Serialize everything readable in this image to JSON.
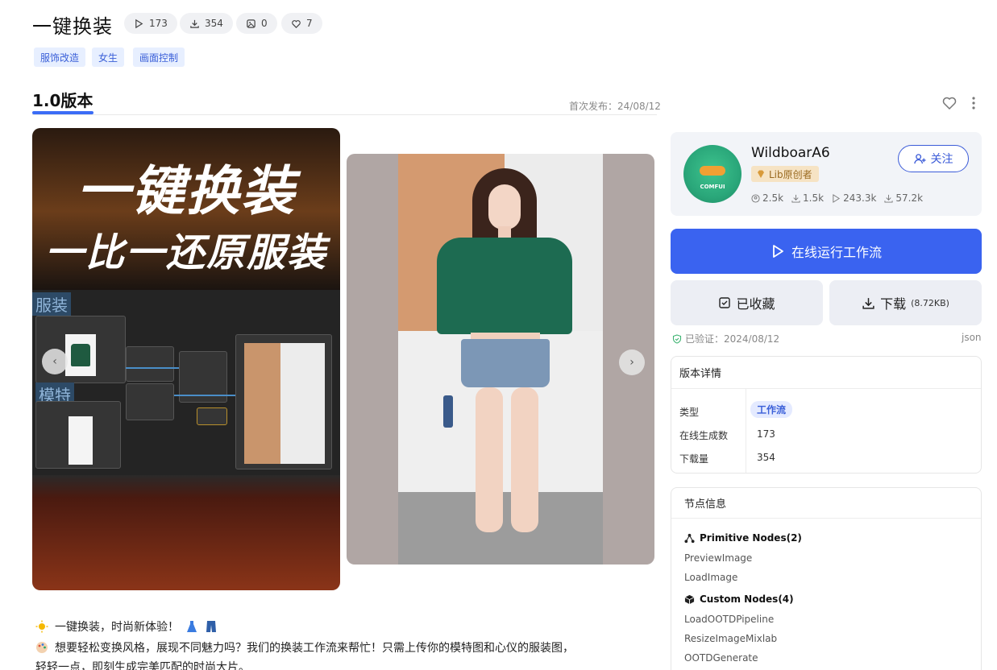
{
  "header": {
    "title": "一键换装",
    "stats": [
      {
        "icon": "play-icon",
        "value": "173"
      },
      {
        "icon": "download-icon",
        "value": "354"
      },
      {
        "icon": "image-icon",
        "value": "0"
      },
      {
        "icon": "heart-icon",
        "value": "7"
      }
    ],
    "tags": [
      "服饰改造",
      "女生",
      "画面控制"
    ]
  },
  "version": {
    "label": "1.0版本",
    "published": "首次发布：24/08/12"
  },
  "gallery": {
    "poster_line1": "一键换装",
    "poster_line2": "一比一还原服装",
    "label_clothes": "服装",
    "label_model": "模特",
    "prev": "‹",
    "next": "›"
  },
  "description": {
    "line1": "一键换装，时尚新体验！",
    "line2": "想要轻松变换风格，展现不同魅力吗？我们的换装工作流来帮忙！只需上传你的模特图和心仪的服装图，",
    "line3": "轻轻一点，即刻生成完美匹配的时尚大片。"
  },
  "author": {
    "name": "WildboarA6",
    "badge": "Lib原创者",
    "avatar_text": "COMFUI",
    "stats": [
      "2.5k",
      "1.5k",
      "243.3k",
      "57.2k"
    ],
    "follow_label": "关注"
  },
  "actions": {
    "run_label": "在线运行工作流",
    "collected_label": "已收藏",
    "download_label": "下载",
    "download_size": "(8.72KB)"
  },
  "verified": {
    "text": "已验证：2024/08/12",
    "json_label": "json"
  },
  "details": {
    "title": "版本详情",
    "rows": [
      {
        "key": "类型",
        "value": "工作流"
      },
      {
        "key": "在线生成数",
        "value": "173"
      },
      {
        "key": "下载量",
        "value": "354"
      }
    ]
  },
  "nodes": {
    "title": "节点信息",
    "primitive_label": "Primitive Nodes(2)",
    "primitive": [
      "PreviewImage",
      "LoadImage"
    ],
    "custom_label": "Custom Nodes(4)",
    "custom": [
      "LoadOOTDPipeline",
      "ResizeImageMixlab",
      "OOTDGenerate"
    ]
  },
  "colors": {
    "accent": "#3a63f0",
    "tag_bg": "#e7efff",
    "badge_bg": "#f6e3c4"
  }
}
